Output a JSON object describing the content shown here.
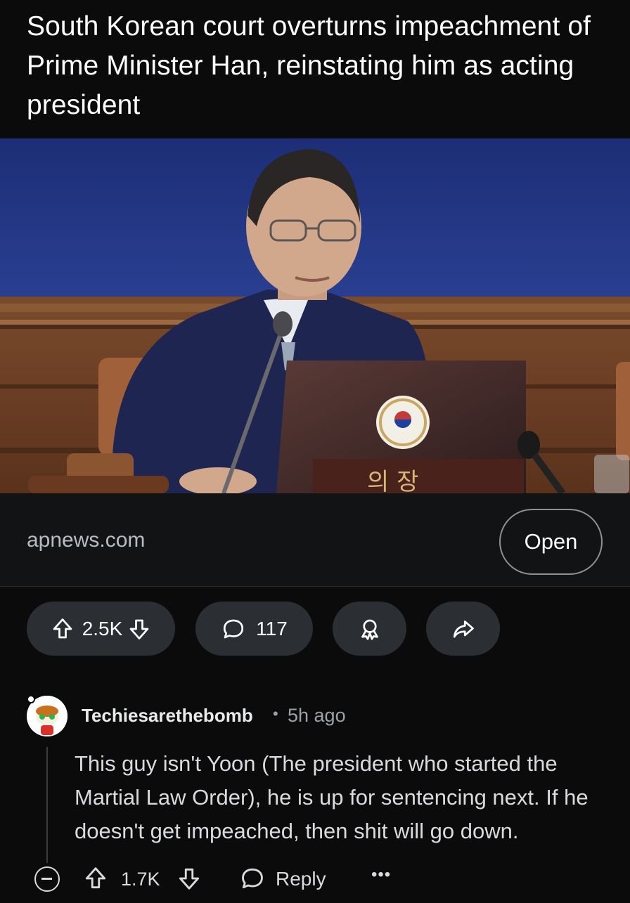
{
  "post": {
    "title": "South Korean court overturns impeachment of Prime Minister Han, reinstating him as acting president",
    "link_domain": "apnews.com",
    "open_label": "Open",
    "score": "2.5K",
    "comments_count": "117"
  },
  "image": {
    "nameplate_text": "의 장"
  },
  "comment": {
    "author": "Techiesarethebomb",
    "separator": "•",
    "time": "5h ago",
    "body": "This guy isn't Yoon (The president who started the Martial Law Order), he is up for sentencing next. If he doesn't get impeached, then shit will go down.",
    "score": "1.7K",
    "reply_label": "Reply",
    "more_label": "•••"
  },
  "icons": {
    "upvote": "upvote-arrow-icon",
    "downvote": "downvote-arrow-icon",
    "comments": "speech-bubble-icon",
    "award": "award-icon",
    "share": "share-arrow-icon",
    "collapse": "minus-circle-icon",
    "reply": "speech-bubble-icon",
    "more": "ellipsis-icon"
  },
  "colors": {
    "background": "#0b0b0c",
    "pill": "#2b2e32",
    "image_backdrop": "#22357f"
  }
}
